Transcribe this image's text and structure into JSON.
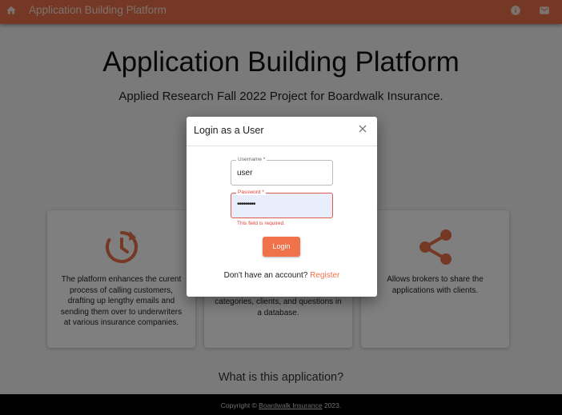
{
  "appbar": {
    "title": "Application Building Platform",
    "icons": {
      "home": "home-icon",
      "info": "info-icon",
      "mail": "mail-icon"
    }
  },
  "hero": {
    "title": "Application Building Platform",
    "subtitle": "Applied Research Fall 2022 Project for Boardwalk Insurance."
  },
  "cards": [
    {
      "icon": "history-icon",
      "text": "The platform enhances the curent process of calling customers, drafting up lengthy emails and sending them over to underwriters at various insurance companies."
    },
    {
      "icon": "database-icon",
      "text": "categories, clients, and questions in a database."
    },
    {
      "icon": "share-icon",
      "text": "Allows brokers to share the applications with clients."
    }
  ],
  "about": {
    "heading": "What is this application?"
  },
  "footer": {
    "prefix": "Copyright © ",
    "link": "Boardwalk Insurance",
    "suffix": " 2023."
  },
  "dialog": {
    "title": "Login as a User",
    "username": {
      "label": "Username *",
      "value": "user"
    },
    "password": {
      "label": "Password *",
      "value": "•••••••••",
      "error": "This field is required."
    },
    "login_label": "Login",
    "register_prompt": "Don't have an account?",
    "register_link": "Register"
  },
  "colors": {
    "accent": "#f0724b",
    "appbar": "#e8714a",
    "error": "#e0423a"
  }
}
